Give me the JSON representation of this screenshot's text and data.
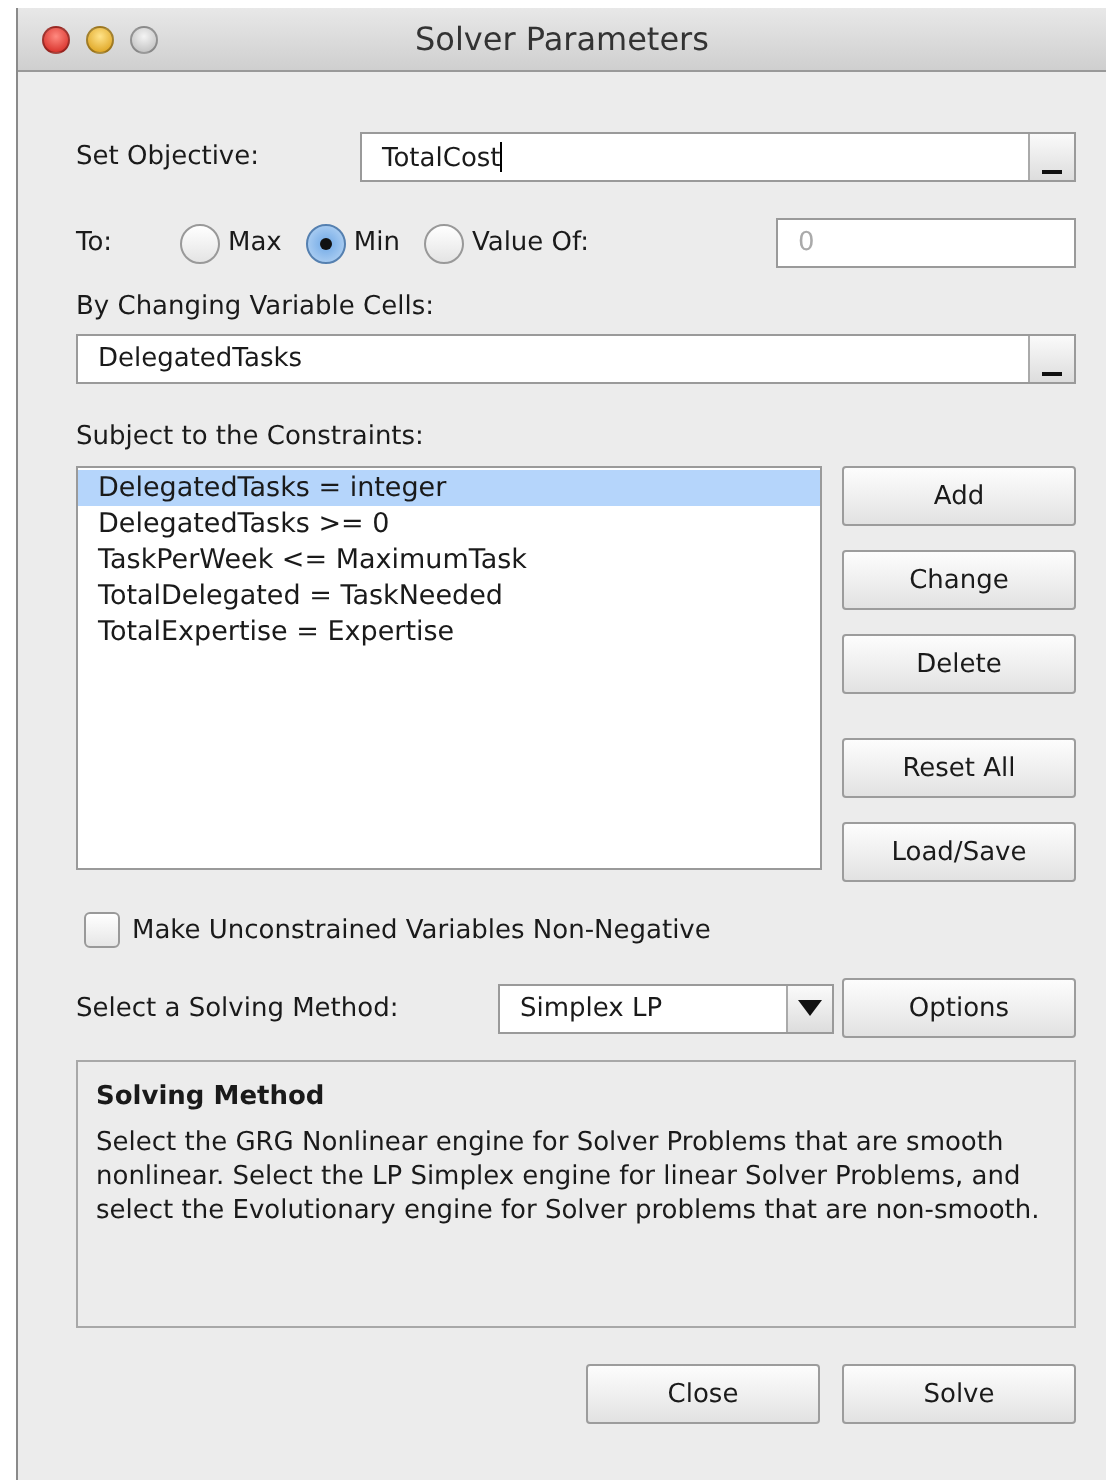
{
  "window": {
    "title": "Solver Parameters"
  },
  "objective": {
    "label": "Set Objective:",
    "value": "TotalCost"
  },
  "to": {
    "label": "To:",
    "options": [
      {
        "label": "Max",
        "selected": false
      },
      {
        "label": "Min",
        "selected": true
      },
      {
        "label": "Value Of:",
        "selected": false
      }
    ],
    "value_of": {
      "value": "0",
      "disabled": true
    }
  },
  "variable_cells": {
    "label": "By Changing Variable Cells:",
    "value": "DelegatedTasks"
  },
  "constraints": {
    "label": "Subject to the Constraints:",
    "items": [
      {
        "text": "DelegatedTasks = integer",
        "selected": true
      },
      {
        "text": "DelegatedTasks >= 0",
        "selected": false
      },
      {
        "text": "TaskPerWeek <= MaximumTask",
        "selected": false
      },
      {
        "text": "TotalDelegated = TaskNeeded",
        "selected": false
      },
      {
        "text": "TotalExpertise = Expertise",
        "selected": false
      }
    ]
  },
  "constraint_buttons": [
    {
      "label": "Add"
    },
    {
      "label": "Change"
    },
    {
      "label": "Delete"
    },
    {
      "label": "Reset All"
    },
    {
      "label": "Load/Save"
    }
  ],
  "non_negative": {
    "label": "Make Unconstrained Variables Non-Negative",
    "checked": false
  },
  "method": {
    "label": "Select a Solving Method:",
    "value": "Simplex LP",
    "options_button": "Options"
  },
  "description": {
    "title": "Solving Method",
    "text": "Select the GRG Nonlinear engine for Solver Problems that are smooth nonlinear. Select the LP Simplex engine for linear Solver Problems, and select the Evolutionary engine for Solver problems that are non-smooth."
  },
  "buttons": [
    "Close",
    "Solve"
  ]
}
